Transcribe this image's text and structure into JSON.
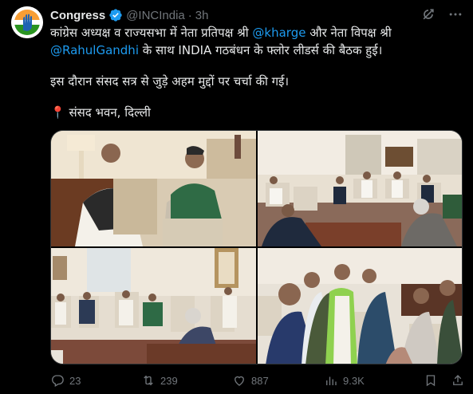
{
  "tweet": {
    "author_name": "Congress",
    "handle": "@INCIndia",
    "separator": "·",
    "time": "3h",
    "text": {
      "line1_prefix": "कांग्रेस अध्यक्ष व राज्यसभा में नेता प्रतिपक्ष श्री ",
      "line1_mention": "@kharge",
      "line1_suffix": " और नेता विपक्ष श्री",
      "line2_mention": "@RahulGandhi",
      "line2_suffix": " के साथ INDIA गठबंधन के फ्लोर लीडर्स की बैठक हुई।",
      "line3": "इस दौरान संसद सत्र से जुड़े अहम मुद्दों पर चर्चा की गई।",
      "location_pin": "📍",
      "location": " संसद भवन, दिल्ली"
    },
    "stats": {
      "replies": "23",
      "retweets": "239",
      "likes": "887",
      "views": "9.3K"
    }
  },
  "colors": {
    "background": "#000000",
    "text": "#e7e9ea",
    "muted": "#71767b",
    "accent": "#1d9bf0",
    "verified": "#1d9bf0",
    "border": "#2f3336"
  },
  "icons": [
    "congress-logo-icon",
    "verified-badge-icon",
    "grok-icon",
    "more-icon",
    "reply-icon",
    "retweet-icon",
    "like-icon",
    "views-icon",
    "bookmark-icon",
    "share-icon"
  ]
}
